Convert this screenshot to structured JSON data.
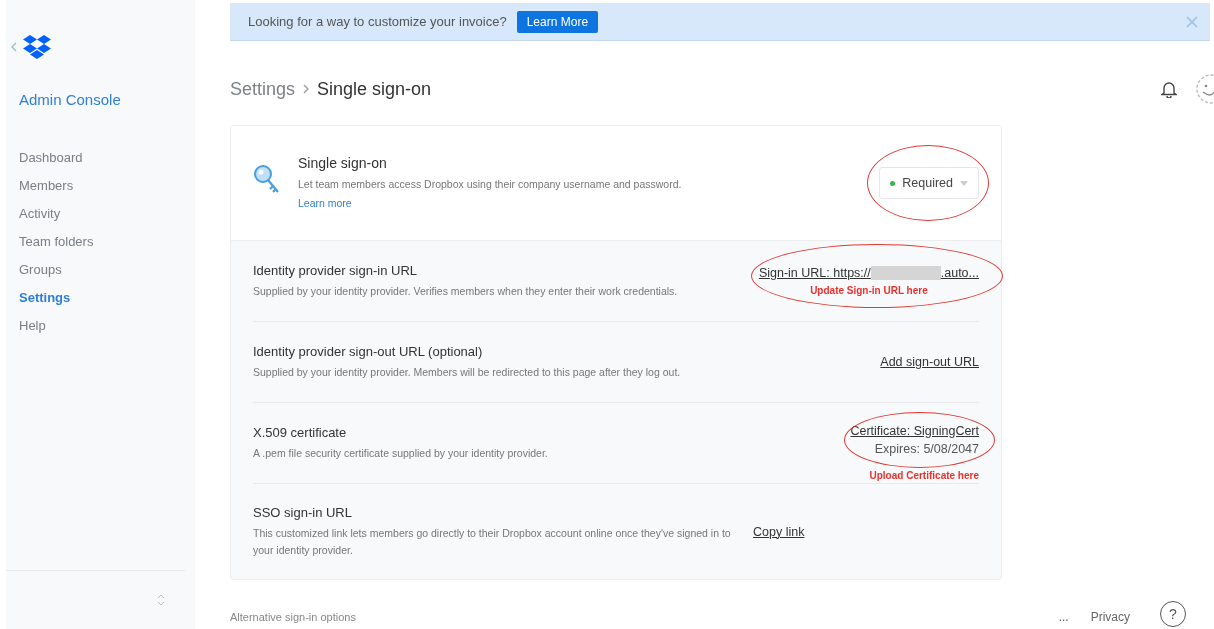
{
  "banner": {
    "text": "Looking for a way to customize your invoice?",
    "button": "Learn More"
  },
  "sidebar": {
    "title": "Admin Console",
    "items": [
      {
        "label": "Dashboard",
        "selected": false
      },
      {
        "label": "Members",
        "selected": false
      },
      {
        "label": "Activity",
        "selected": false
      },
      {
        "label": "Team folders",
        "selected": false
      },
      {
        "label": "Groups",
        "selected": false
      },
      {
        "label": "Settings",
        "selected": true
      },
      {
        "label": "Help",
        "selected": false
      }
    ]
  },
  "breadcrumb": {
    "parent": "Settings",
    "current": "Single sign-on"
  },
  "sso": {
    "title": "Single sign-on",
    "description": "Let team members access Dropbox using their company username and password.",
    "link": "Learn more",
    "status": "Required",
    "annotated": true
  },
  "rows": [
    {
      "kind": "url",
      "title": "Identity provider sign-in URL",
      "description": "Supplied by your identity provider. Verifies members when they enter their work credentials.",
      "prefix": "Sign-in URL: https://",
      "suffix": ".auto...",
      "note": "Update Sign-in URL here",
      "annotated": true
    },
    {
      "kind": "link",
      "title": "Identity provider sign-out URL (optional)",
      "description": "Supplied by your identity provider. Members will be redirected to this page after they log out.",
      "action": "Add sign-out URL"
    },
    {
      "kind": "certificate",
      "title": "X.509 certificate",
      "description": "A .pem file security certificate supplied by your identity provider.",
      "certificate": "Certificate: SigningCert",
      "expires": "Expires: 5/08/2047",
      "note": "Upload Certificate here",
      "annotated": true
    },
    {
      "kind": "link",
      "title": "SSO sign-in URL",
      "description": "This customized link lets members go directly to their Dropbox account online once they've signed in to your identity provider.",
      "action": "Copy link"
    }
  ],
  "footer": {
    "text": "Alternative sign-in options",
    "more": "...",
    "privacy": "Privacy",
    "help": "?"
  }
}
